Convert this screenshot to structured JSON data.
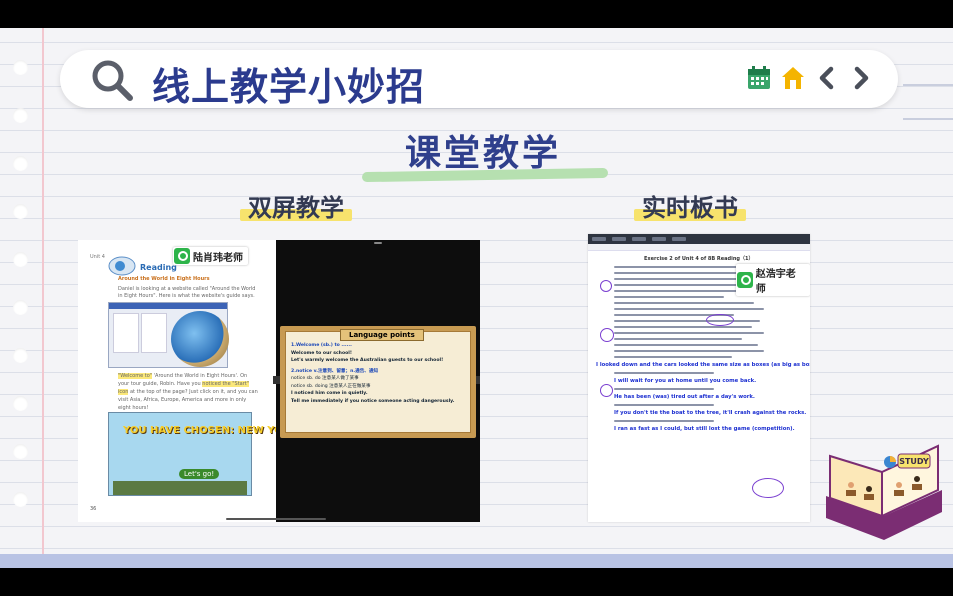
{
  "header": {
    "title": "线上教学小妙招",
    "icons": [
      "search-icon",
      "calendar-icon",
      "home-icon",
      "chevron-left-icon",
      "chevron-right-icon"
    ]
  },
  "section": {
    "title": "课堂教学"
  },
  "left_panel": {
    "label": "双屏教学",
    "teacher_tag": "陆肖玮老师",
    "textbook_heading": "Reading",
    "textbook_subheading": "Around the World in Eight Hours",
    "poster_text": "YOU HAVE CHOSEN: NEW YORK",
    "poster_subtext": "Let's go!",
    "page_number": "36",
    "board_title": "Language points",
    "board_lines": [
      "1.Welcome (sb.) to ......",
      "Welcome to our school!",
      "Let's warmly welcome the Australian guests to our school!",
      "2.notice v.注意到、留意；n.通告、通知",
      "notice sb. do  注意某人做了某事",
      "notice sb. doing  注意某人正在做某事",
      "I noticed him come in quietly.",
      "Tell me immediately if you notice someone acting dangerously."
    ]
  },
  "right_panel": {
    "label": "实时板书",
    "teacher_tag": "赵浩宇老师",
    "doc_title": "Exercise 2 of Unit 4 of 8B  Reading（1）",
    "handwritten_lines": [
      "I looked down and the cars looked the same size as boxes (as big as boxes).",
      "I will wait for you at home until you come back.",
      "He has been (was) tired out after a day's work.",
      "If you don't tie the boat to the tree, it'll crash against the rocks.",
      "I ran as fast as I could, but still lost the game (competition)."
    ]
  },
  "illustration": {
    "label": "STUDY"
  },
  "colors": {
    "title_blue": "#2b3b8e",
    "highlight_yellow": "#f7e36d",
    "underline_green": "#b6e0b0",
    "ink_blue": "#1c2fd0"
  }
}
